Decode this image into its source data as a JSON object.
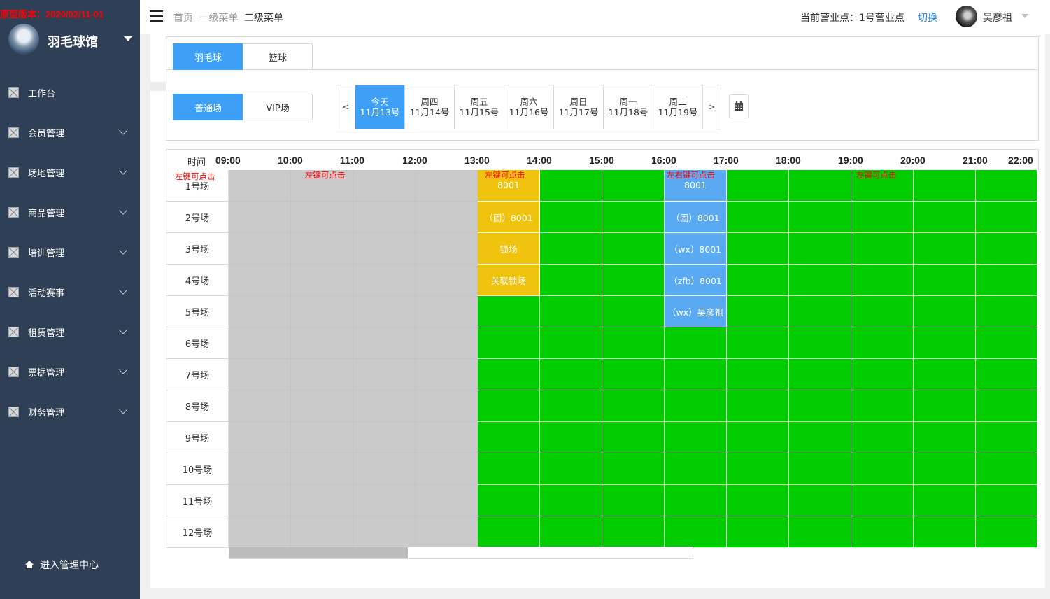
{
  "prototype_version": "原型版本：2020/02/11-01",
  "brand": {
    "name": "羽毛球馆"
  },
  "sidebar": {
    "items": [
      {
        "label": "工作台",
        "has_children": false
      },
      {
        "label": "会员管理",
        "has_children": true
      },
      {
        "label": "场地管理",
        "has_children": true
      },
      {
        "label": "商品管理",
        "has_children": true
      },
      {
        "label": "培训管理",
        "has_children": true
      },
      {
        "label": "活动赛事",
        "has_children": true
      },
      {
        "label": "租赁管理",
        "has_children": true
      },
      {
        "label": "票据管理",
        "has_children": true
      },
      {
        "label": "财务管理",
        "has_children": true
      }
    ],
    "admin_link": "进入管理中心"
  },
  "header": {
    "breadcrumb": [
      "首页",
      "一级菜单",
      "二级菜单"
    ],
    "store_label": "当前营业点：1号营业点",
    "switch_label": "切换",
    "user_name": "吴彦祖"
  },
  "sport_tabs": [
    {
      "label": "羽毛球",
      "active": true
    },
    {
      "label": "篮球",
      "active": false
    }
  ],
  "court_type_tabs": [
    {
      "label": "普通场",
      "active": true
    },
    {
      "label": "VIP场",
      "active": false
    }
  ],
  "date_nav": {
    "prev": "<",
    "next": ">",
    "days": [
      {
        "day": "今天",
        "date": "11月13号",
        "active": true
      },
      {
        "day": "周四",
        "date": "11月14号",
        "active": false
      },
      {
        "day": "周五",
        "date": "11月15号",
        "active": false
      },
      {
        "day": "周六",
        "date": "11月16号",
        "active": false
      },
      {
        "day": "周日",
        "date": "11月17号",
        "active": false
      },
      {
        "day": "周一",
        "date": "11月18号",
        "active": false
      },
      {
        "day": "周二",
        "date": "11月19号",
        "active": false
      }
    ]
  },
  "schedule": {
    "time_header": "时间",
    "times": [
      "09:00",
      "10:00",
      "11:00",
      "12:00",
      "13:00",
      "14:00",
      "15:00",
      "16:00",
      "17:00",
      "18:00",
      "19:00",
      "20:00",
      "21:00",
      "22:00"
    ],
    "courts": [
      "1号场",
      "2号场",
      "3号场",
      "4号场",
      "5号场",
      "6号场",
      "7号场",
      "8号场",
      "9号场",
      "10号场",
      "11号场",
      "12号场"
    ],
    "past_slot_count": 4,
    "bookings": [
      {
        "court": 0,
        "slot": 4,
        "text": "8001",
        "color": "yellow"
      },
      {
        "court": 1,
        "slot": 4,
        "text": "（固）8001",
        "color": "yellow"
      },
      {
        "court": 2,
        "slot": 4,
        "text": "锁场",
        "color": "yellow"
      },
      {
        "court": 3,
        "slot": 4,
        "text": "关联锁场",
        "color": "yellow"
      },
      {
        "court": 0,
        "slot": 7,
        "text": "8001",
        "color": "blue"
      },
      {
        "court": 1,
        "slot": 7,
        "text": "（固）8001",
        "color": "blue"
      },
      {
        "court": 2,
        "slot": 7,
        "text": "（wx）8001",
        "color": "blue"
      },
      {
        "court": 3,
        "slot": 7,
        "text": "（zfb）8001",
        "color": "blue"
      },
      {
        "court": 4,
        "slot": 7,
        "text": "（wx）吴彦祖",
        "color": "blue"
      }
    ],
    "notes": [
      {
        "text": "左键可点击",
        "anchor": "court-col"
      },
      {
        "text": "左键可点击",
        "anchor": "past"
      },
      {
        "text": "左键可点击",
        "anchor": "yellow"
      },
      {
        "text": "左右键可点击",
        "anchor": "blue"
      },
      {
        "text": "左键可点击",
        "anchor": "free"
      }
    ]
  }
}
